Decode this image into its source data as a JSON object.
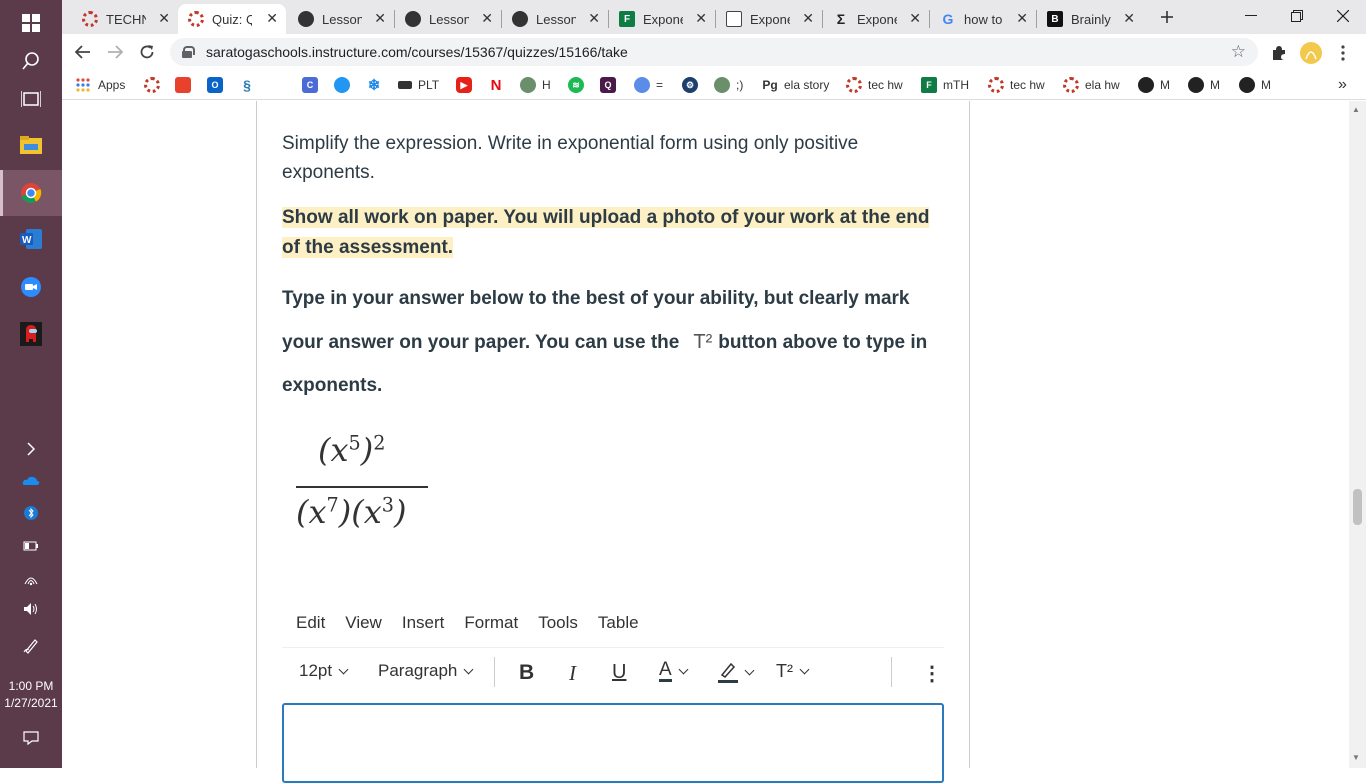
{
  "taskbar": {
    "clock_time": "1:00 PM",
    "clock_date": "1/27/2021"
  },
  "tabs": [
    {
      "title": "TECHNO",
      "close": "✕",
      "color": "#c0392b"
    },
    {
      "title": "Quiz: Qu",
      "close": "✕",
      "color": "#c0392b"
    },
    {
      "title": "Lesson -",
      "close": "✕",
      "color": "#333333"
    },
    {
      "title": "Lesson -",
      "close": "✕",
      "color": "#333333"
    },
    {
      "title": "Lesson -",
      "close": "✕",
      "color": "#333333"
    },
    {
      "title": "Expone",
      "close": "✕",
      "color": "#0f7b45"
    },
    {
      "title": "Expone",
      "close": "✕",
      "color": "#444444"
    },
    {
      "title": "Expone",
      "close": "✕",
      "color": "#222222"
    },
    {
      "title": "how to",
      "close": "✕",
      "color": "#4285f4"
    },
    {
      "title": "Brainly.c",
      "close": "✕",
      "color": "#111111"
    }
  ],
  "address": {
    "url": "saratogaschools.instructure.com/courses/15367/quizzes/15166/take"
  },
  "bookmarks": {
    "apps": "Apps",
    "plt": "PLT",
    "h": "H",
    "eq": "=",
    "smile": ";)",
    "ela_story": "ela story",
    "tec_hw_1": "tec hw",
    "mth": "mTH",
    "tec_hw_2": "tec hw",
    "ela_hw": "ela hw",
    "m1": "M",
    "m2": "M",
    "m3": "M",
    "more": "»"
  },
  "question": {
    "line1": "Simplify the expression.  Write in exponential form using only positive exponents.",
    "highlight": "Show all work on paper.  You will upload a photo of your work at the end of the assessment.",
    "instr_a": "Type in your answer below to the best of your ability, but clearly mark your answer on your paper.  You can use the",
    "instr_t2": "T²",
    "instr_b": "button above to type in exponents."
  },
  "editor": {
    "menu": [
      "Edit",
      "View",
      "Insert",
      "Format",
      "Tools",
      "Table"
    ],
    "font_size": "12pt",
    "block": "Paragraph",
    "bold": "B",
    "italic": "I",
    "underline": "U",
    "text_color": "A",
    "superscript": "T²",
    "more": "⋮"
  }
}
